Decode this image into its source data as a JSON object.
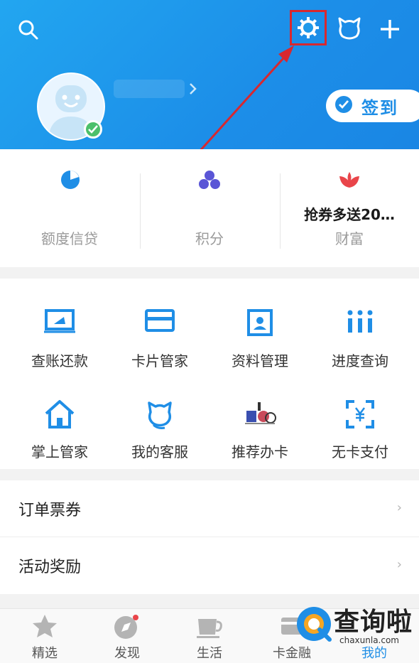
{
  "header": {
    "signin_label": "签到",
    "accent_color": "#1f8ee6",
    "icons": [
      "search-icon",
      "settings-gear-icon",
      "mascot-cat-icon",
      "plus-icon"
    ]
  },
  "stats": [
    {
      "label": "额度信贷",
      "value": "",
      "icon": "pie-chart-icon"
    },
    {
      "label": "积分",
      "value": "",
      "icon": "points-dots-icon"
    },
    {
      "label": "财富",
      "value": "抢券多送20…",
      "icon": "lotus-icon"
    }
  ],
  "grid": [
    {
      "label": "查账还款",
      "icon": "bill-icon"
    },
    {
      "label": "卡片管家",
      "icon": "card-icon"
    },
    {
      "label": "资料管理",
      "icon": "profile-icon"
    },
    {
      "label": "进度查询",
      "icon": "progress-icon"
    },
    {
      "label": "掌上管家",
      "icon": "home-icon"
    },
    {
      "label": "我的客服",
      "icon": "headset-mascot-icon"
    },
    {
      "label": "推荐办卡",
      "icon": "recommend-card-icon"
    },
    {
      "label": "无卡支付",
      "icon": "scan-pay-icon"
    }
  ],
  "list": [
    {
      "label": "订单票券"
    },
    {
      "label": "活动奖励"
    }
  ],
  "tabs": [
    {
      "label": "精选",
      "icon": "star-icon"
    },
    {
      "label": "发现",
      "icon": "compass-icon"
    },
    {
      "label": "生活",
      "icon": "cup-icon"
    },
    {
      "label": "卡金融",
      "icon": "wallet-icon"
    },
    {
      "label": "我的",
      "icon": "user-icon",
      "active": true
    }
  ],
  "watermark": {
    "cn": "查询啦",
    "domain": "chaxunla.com"
  }
}
